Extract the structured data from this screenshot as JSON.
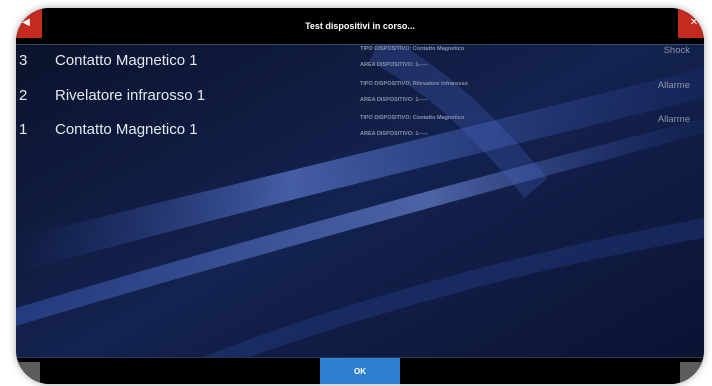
{
  "header": {
    "title": "Test dispositivi in corso...",
    "left_button_icon": "back-icon",
    "right_button_icon": "close-icon"
  },
  "devices": [
    {
      "number": "3",
      "name": "Contatto Magnetico 1",
      "type": "TIPO DISPOSITIVO: Contatto Magnetico",
      "area": "AREA DISPOSITIVO: 1-----",
      "status": "Shock"
    },
    {
      "number": "2",
      "name": "Rivelatore infrarosso 1",
      "type": "TIPO DISPOSITIVO: Rilevatore infrarosso",
      "area": "AREA DISPOSITIVO: 1-----",
      "status": "Allarme"
    },
    {
      "number": "1",
      "name": "Contatto Magnetico 1",
      "type": "TIPO DISPOSITIVO: Contatto Magnetico",
      "area": "AREA DISPOSITIVO: 1-----",
      "status": "Allarme"
    }
  ],
  "footer": {
    "ok_label": "OK"
  },
  "colors": {
    "accent_blue": "#2f7fd0",
    "corner_red": "#c62a1e",
    "background": "#0c1430"
  }
}
